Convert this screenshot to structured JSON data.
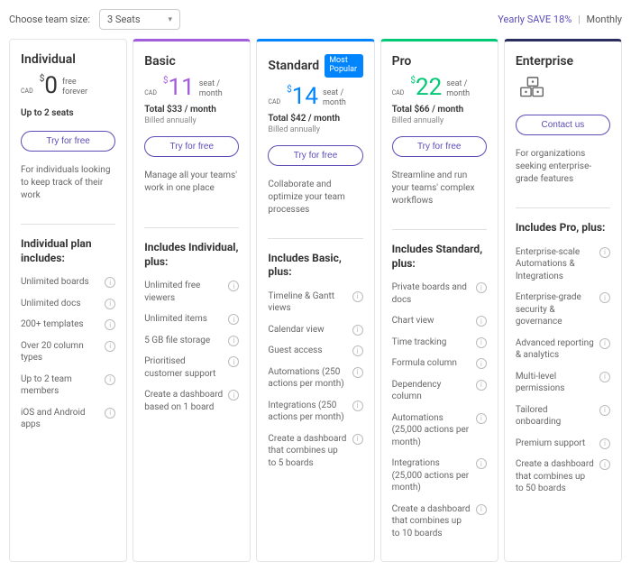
{
  "topbar": {
    "team_size_label": "Choose team size:",
    "seats_value": "3 Seats",
    "billing_yearly": "Yearly SAVE 18%",
    "billing_monthly": "Monthly"
  },
  "plans": [
    {
      "key": "individual",
      "name": "Individual",
      "currency": "$",
      "amount": "0",
      "cad": "CAD",
      "unit_line1": "free",
      "unit_line2": "forever",
      "seats_limit": "Up to 2 seats",
      "cta": "Try for free",
      "tagline": "For individuals looking to keep track of their work",
      "features_title": "Individual plan includes:",
      "features": [
        "Unlimited boards",
        "Unlimited docs",
        "200+ templates",
        "Over 20 column types",
        "Up to 2 team members",
        "iOS and Android apps"
      ]
    },
    {
      "key": "basic",
      "name": "Basic",
      "currency": "$",
      "amount": "11",
      "cad": "CAD",
      "unit_line1": "seat /",
      "unit_line2": "month",
      "total": "Total $33 / month",
      "billed": "Billed annually",
      "cta": "Try for free",
      "tagline": "Manage all your teams' work in one place",
      "features_title": "Includes Individual, plus:",
      "features": [
        "Unlimited free viewers",
        "Unlimited items",
        "5 GB file storage",
        "Prioritised customer support",
        "Create a dashboard based on 1 board"
      ]
    },
    {
      "key": "standard",
      "name": "Standard",
      "badge": "Most Popular",
      "currency": "$",
      "amount": "14",
      "cad": "CAD",
      "unit_line1": "seat /",
      "unit_line2": "month",
      "total": "Total $42 / month",
      "billed": "Billed annually",
      "cta": "Try for free",
      "tagline": "Collaborate and optimize your team processes",
      "features_title": "Includes Basic, plus:",
      "features": [
        "Timeline & Gantt views",
        "Calendar view",
        "Guest access",
        "Automations (250 actions per month)",
        "Integrations (250 actions per month)",
        "Create a dashboard that combines up to 5 boards"
      ]
    },
    {
      "key": "pro",
      "name": "Pro",
      "currency": "$",
      "amount": "22",
      "cad": "CAD",
      "unit_line1": "seat /",
      "unit_line2": "month",
      "total": "Total $66 / month",
      "billed": "Billed annually",
      "cta": "Try for free",
      "tagline": "Streamline and run your teams' complex workflows",
      "features_title": "Includes Standard, plus:",
      "features": [
        "Private boards and docs",
        "Chart view",
        "Time tracking",
        "Formula column",
        "Dependency column",
        "Automations (25,000 actions per month)",
        "Integrations (25,000 actions per month)",
        "Create a dashboard that combines up to 10 boards"
      ]
    },
    {
      "key": "enterprise",
      "name": "Enterprise",
      "cta": "Contact us",
      "tagline": "For organizations seeking enterprise-grade features",
      "features_title": "Includes Pro, plus:",
      "features": [
        "Enterprise-scale Automations & Integrations",
        "Enterprise-grade security & governance",
        "Advanced reporting & analytics",
        "Multi-level permissions",
        "Tailored onboarding",
        "Premium support",
        "Create a dashboard that combines up to 50 boards"
      ]
    }
  ]
}
